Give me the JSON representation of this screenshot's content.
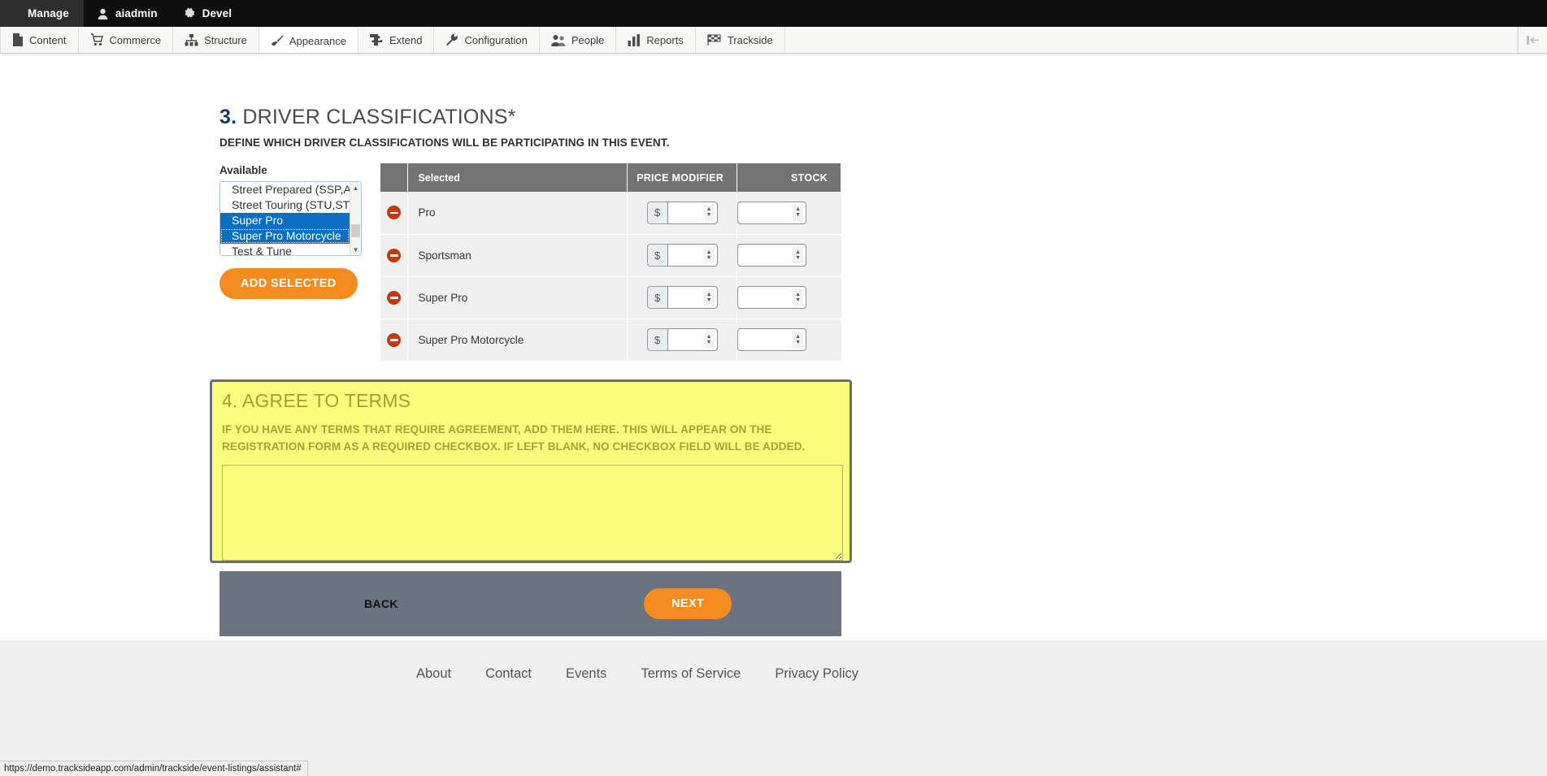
{
  "admin_toolbar": {
    "items": [
      {
        "label": "Manage",
        "icon": "hamburger-icon"
      },
      {
        "label": "aiadmin",
        "icon": "user-icon"
      },
      {
        "label": "Devel",
        "icon": "gear-icon"
      }
    ]
  },
  "admin_menu": {
    "items": [
      {
        "label": "Content",
        "icon": "file-icon"
      },
      {
        "label": "Commerce",
        "icon": "cart-icon"
      },
      {
        "label": "Structure",
        "icon": "structure-icon"
      },
      {
        "label": "Appearance",
        "icon": "paintbrush-icon"
      },
      {
        "label": "Extend",
        "icon": "puzzle-icon"
      },
      {
        "label": "Configuration",
        "icon": "wrench-icon"
      },
      {
        "label": "People",
        "icon": "people-icon"
      },
      {
        "label": "Reports",
        "icon": "bar-chart-icon"
      },
      {
        "label": "Trackside",
        "icon": "checkered-flag-icon"
      }
    ],
    "collapse_icon": "collapse-toolbar-icon"
  },
  "section3": {
    "number": "3.",
    "title": "DRIVER CLASSIFICATIONS*",
    "description": "DEFINE WHICH DRIVER CLASSIFICATIONS WILL BE PARTICIPATING IN THIS EVENT.",
    "available_label": "Available",
    "available_options": [
      {
        "label": "Street Prepared (SSP,ASP",
        "selected": false
      },
      {
        "label": "Street Touring (STU,STR,S",
        "selected": false
      },
      {
        "label": "Super Pro",
        "selected": true
      },
      {
        "label": "Super Pro Motorcycle",
        "selected": true,
        "focused": true
      },
      {
        "label": "Test & Tune",
        "selected": false
      }
    ],
    "add_button": "ADD SELECTED",
    "table": {
      "headers": [
        "",
        "Selected",
        "PRICE MODIFIER",
        "STOCK"
      ],
      "rows": [
        {
          "name": "Pro",
          "price_prefix": "$",
          "price": "",
          "stock": ""
        },
        {
          "name": "Sportsman",
          "price_prefix": "$",
          "price": "",
          "stock": ""
        },
        {
          "name": "Super Pro",
          "price_prefix": "$",
          "price": "",
          "stock": ""
        },
        {
          "name": "Super Pro Motorcycle",
          "price_prefix": "$",
          "price": "",
          "stock": ""
        }
      ]
    }
  },
  "section4": {
    "title": "4. AGREE TO TERMS",
    "description": "IF YOU HAVE ANY TERMS THAT REQUIRE AGREEMENT, ADD THEM HERE. THIS WILL APPEAR ON THE REGISTRATION FORM AS A REQUIRED CHECKBOX. IF LEFT BLANK, NO CHECKBOX FIELD WILL BE ADDED.",
    "textarea_value": "",
    "textarea_placeholder": ""
  },
  "wizard_nav": {
    "back": "BACK",
    "next": "NEXT"
  },
  "site_footer": {
    "links": [
      "About",
      "Contact",
      "Events",
      "Terms of Service",
      "Privacy Policy"
    ]
  },
  "status_bar": {
    "url": "https://demo.tracksideapp.com/admin/trackside/event-listings/assistant#"
  },
  "colors": {
    "accent_orange": "#f68b1f",
    "select_blue": "#0a6fc2",
    "terms_yellow": "#fbfb7c",
    "nav_gray": "#6b7280",
    "table_header_gray": "#737373",
    "remove_red": "#c33a11",
    "section_number_blue": "#1b3a63"
  }
}
